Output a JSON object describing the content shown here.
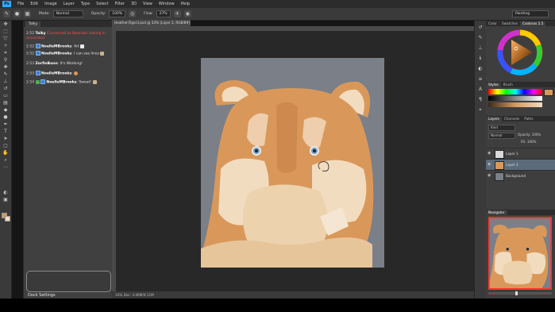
{
  "menu": {
    "logo": "Ps",
    "items": [
      "File",
      "Edit",
      "Image",
      "Layer",
      "Type",
      "Select",
      "Filter",
      "3D",
      "View",
      "Window",
      "Help"
    ]
  },
  "options": {
    "mode_label": "Mode:",
    "mode_value": "Normal",
    "opacity_label": "Opacity:",
    "opacity_value": "100%",
    "flow_label": "Flow:",
    "flow_value": "27%",
    "workspace": "Painting"
  },
  "document": {
    "tab_title": "HeathenTiger3.psd @ 33% (Layer 2, RGB/8#) ×",
    "status": "33%      Doc: 3.06M/9.11M"
  },
  "talky": {
    "tab": "Talky",
    "messages": [
      {
        "time": "2:52",
        "name": "Talky",
        "text": "Connected as Noeliebc talking in annotated",
        "error": true
      },
      {
        "time": "2:52",
        "name": "NoelleMBrooks",
        "text": "Art",
        "emoji": true
      },
      {
        "time": "2:52",
        "name": "NoelleMBrooks",
        "text": "I can see lines",
        "emoji": true
      },
      {
        "time": "2:53",
        "name": "ZorfinBunn",
        "text": "It's Working!",
        "emoji": false
      },
      {
        "time": "2:53",
        "name": "NoelleMBrooks",
        "text": "",
        "emoji": true
      },
      {
        "time": "2:54",
        "name": "NoelleMBrooks",
        "text": "Sweet!",
        "emoji": true
      }
    ],
    "dock_settings": "Dock Settings"
  },
  "panels": {
    "color_tabs": [
      "Color",
      "Swatches",
      "Coolorus 2.5"
    ],
    "styles_tabs": [
      "Styles",
      "Brush"
    ],
    "layers_tabs": [
      "Layers",
      "Channels",
      "Paths"
    ],
    "kind_label": "Kind",
    "blend_mode": "Normal",
    "opacity_label": "Opacity:",
    "opacity_value": "100%",
    "fill_label": "Fill:",
    "fill_value": "100%",
    "layers": [
      {
        "name": "Layer 1",
        "selected": false
      },
      {
        "name": "Layer 2",
        "selected": true
      },
      {
        "name": "Background",
        "selected": false
      }
    ],
    "navigator_tab": "Navigator"
  },
  "colors": {
    "accent": "#31a8ff",
    "canvas_bg": "#7a7f88",
    "fur": "#d9985a",
    "fur_light": "#f2dcc0",
    "selection": "#5c6b7a",
    "error": "#ff4b4b"
  }
}
